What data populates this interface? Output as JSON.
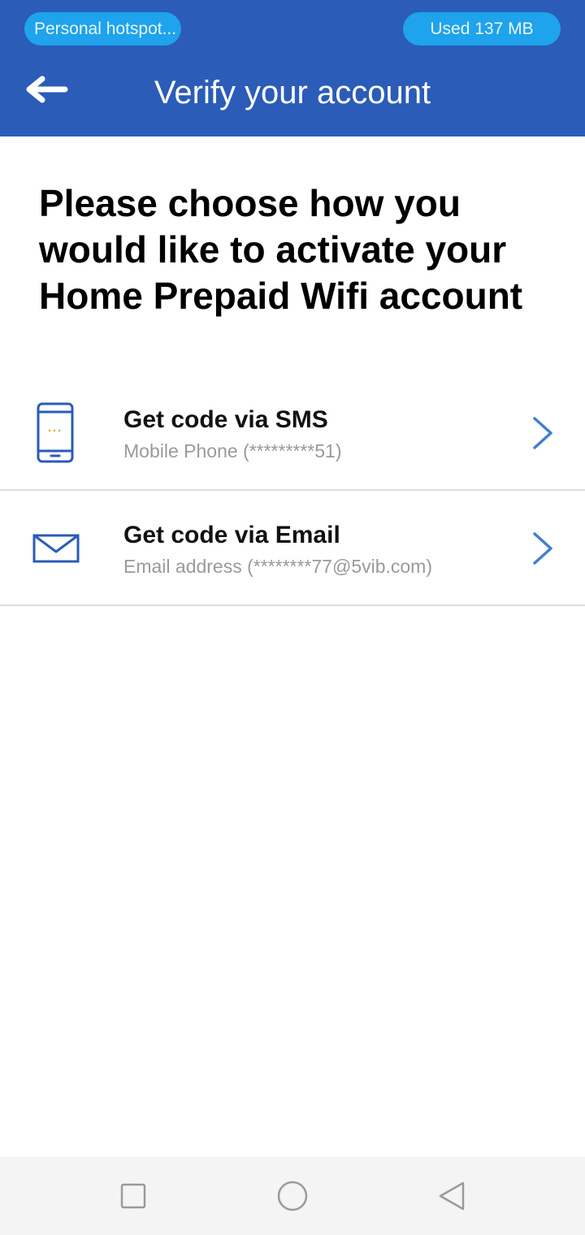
{
  "status": {
    "hotspot_label": "Personal hotspot...",
    "usage_label": "Used  137 MB"
  },
  "header": {
    "title": "Verify your account",
    "back_icon": "arrow-left-icon"
  },
  "main": {
    "heading": "Please choose how you would like to activate your Home Prepaid Wifi account",
    "options": [
      {
        "icon": "mobile-phone-icon",
        "title": "Get code via SMS",
        "subtitle": "Mobile Phone (*********51)"
      },
      {
        "icon": "envelope-icon",
        "title": "Get code via Email",
        "subtitle": "Email address (********77@5vib.com)"
      }
    ]
  },
  "navbar": {
    "icons": [
      "recents-square-icon",
      "home-circle-icon",
      "back-triangle-icon"
    ]
  },
  "colors": {
    "header_bg": "#2a5cb8",
    "pill_bg": "#1ea3ec",
    "icon_blue": "#2a5cb8",
    "chevron_blue": "#3f7fd0"
  }
}
